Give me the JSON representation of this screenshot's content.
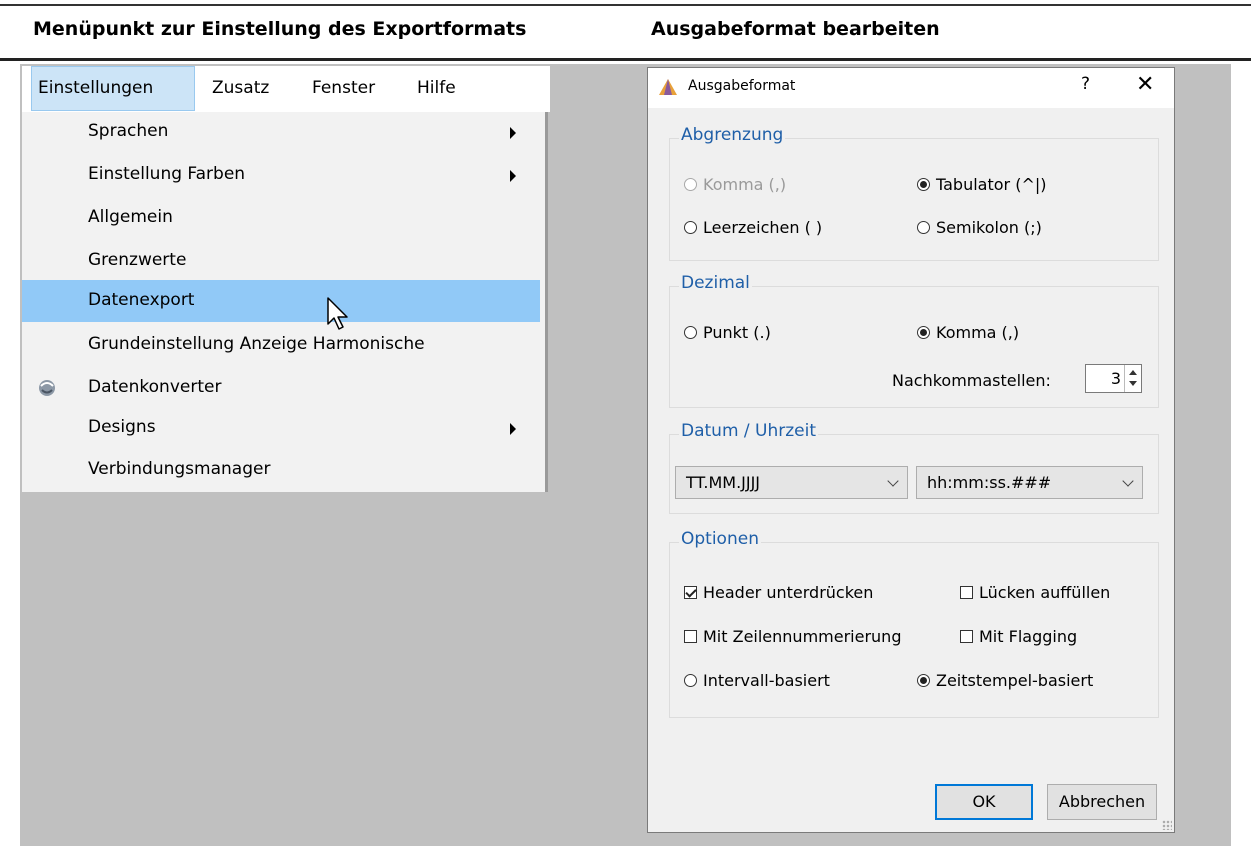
{
  "headings": {
    "left": "Menüpunkt zur Einstellung des Exportformats",
    "right": "Ausgabeformat bearbeiten"
  },
  "menubar": {
    "items": [
      "Einstellungen",
      "Zusatz",
      "Fenster",
      "Hilfe"
    ],
    "active": "Einstellungen"
  },
  "dropdown": {
    "items": [
      {
        "label": "Sprachen",
        "submenu": true
      },
      {
        "label": "Einstellung Farben",
        "submenu": true
      },
      {
        "label": "Allgemein",
        "submenu": false
      },
      {
        "label": "Grenzwerte",
        "submenu": false
      },
      {
        "label": "Datenexport",
        "submenu": false,
        "highlighted": true
      },
      {
        "label": "Grundeinstellung Anzeige Harmonische",
        "submenu": false
      },
      {
        "label": "Datenkonverter",
        "submenu": false,
        "icon": "converter-icon"
      },
      {
        "label": "Designs",
        "submenu": true
      },
      {
        "label": "Verbindungsmanager",
        "submenu": false
      }
    ]
  },
  "dialog": {
    "title": "Ausgabeformat",
    "help": "?",
    "close": "✕",
    "abgrenzung": {
      "title": "Abgrenzung",
      "komma": "Komma (,)",
      "tabulator": "Tabulator (^|)",
      "leerzeichen": "Leerzeichen ( )",
      "semikolon": "Semikolon (;)",
      "selected": "Tabulator (^|)"
    },
    "dezimal": {
      "title": "Dezimal",
      "punkt": "Punkt (.)",
      "komma": "Komma (,)",
      "selected": "Komma (,)",
      "nachkomma_label": "Nachkommastellen:",
      "nachkomma_value": "3"
    },
    "datum": {
      "title": "Datum / Uhrzeit",
      "date_format": "TT.MM.JJJJ",
      "time_format": "hh:mm:ss.###"
    },
    "optionen": {
      "title": "Optionen",
      "header": "Header unterdrücken",
      "header_checked": true,
      "luecken": "Lücken auffüllen",
      "luecken_checked": false,
      "zeilen": "Mit Zeilennummerierung",
      "zeilen_checked": false,
      "flagging": "Mit Flagging",
      "flagging_checked": false,
      "intervall": "Intervall-basiert",
      "zeitstempel": "Zeitstempel-basiert",
      "selected": "Zeitstempel-basiert"
    },
    "ok": "OK",
    "cancel": "Abbrechen"
  },
  "colors": {
    "menu_highlight": "#91c9f7",
    "menubar_active": "#cce4f7",
    "group_title": "#1f5fa8",
    "background": "#c0c0c0",
    "ok_border": "#0078d7"
  }
}
